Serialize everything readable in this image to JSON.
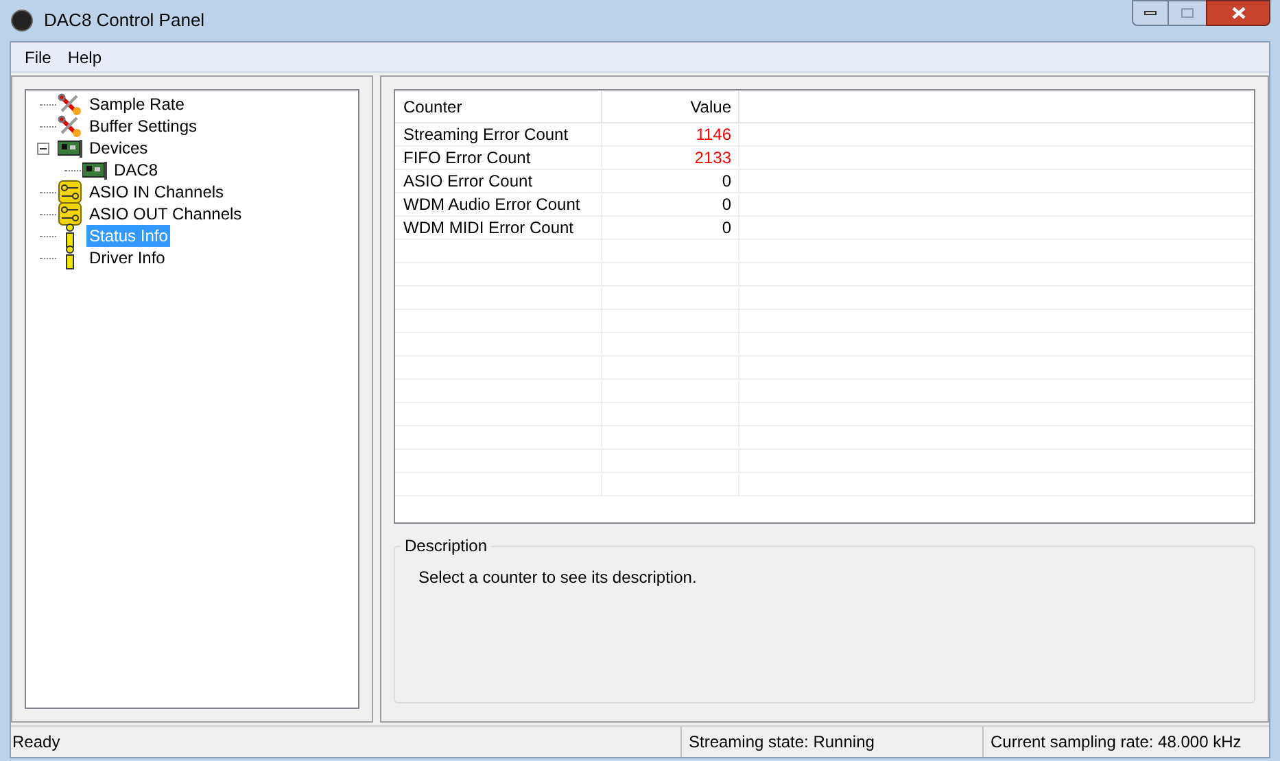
{
  "window": {
    "title": "DAC8 Control Panel"
  },
  "menu": [
    "File",
    "Help"
  ],
  "tree": [
    {
      "label": "Sample Rate",
      "kind": "tools",
      "selected": false
    },
    {
      "label": "Buffer Settings",
      "kind": "tools",
      "selected": false
    },
    {
      "label": "Devices",
      "kind": "card",
      "selected": false,
      "expanded": true,
      "children": [
        {
          "label": "DAC8",
          "kind": "card",
          "selected": false
        }
      ]
    },
    {
      "label": "ASIO IN Channels",
      "kind": "connector",
      "selected": false
    },
    {
      "label": "ASIO OUT Channels",
      "kind": "connector",
      "selected": false
    },
    {
      "label": "Status Info",
      "kind": "info",
      "selected": true
    },
    {
      "label": "Driver Info",
      "kind": "info",
      "selected": false
    }
  ],
  "table": {
    "columns": [
      "Counter",
      "Value"
    ],
    "rows": [
      {
        "counter": "Streaming Error Count",
        "value": "1146",
        "error": true
      },
      {
        "counter": "FIFO Error Count",
        "value": "2133",
        "error": true
      },
      {
        "counter": "ASIO Error Count",
        "value": "0",
        "error": false
      },
      {
        "counter": "WDM Audio Error Count",
        "value": "0",
        "error": false
      },
      {
        "counter": "WDM MIDI Error Count",
        "value": "0",
        "error": false
      }
    ]
  },
  "description": {
    "title": "Description",
    "text": "Select a counter to see its description."
  },
  "status_bar": [
    "Ready",
    "Streaming state: Running",
    "Current sampling rate: 48.000 kHz"
  ]
}
